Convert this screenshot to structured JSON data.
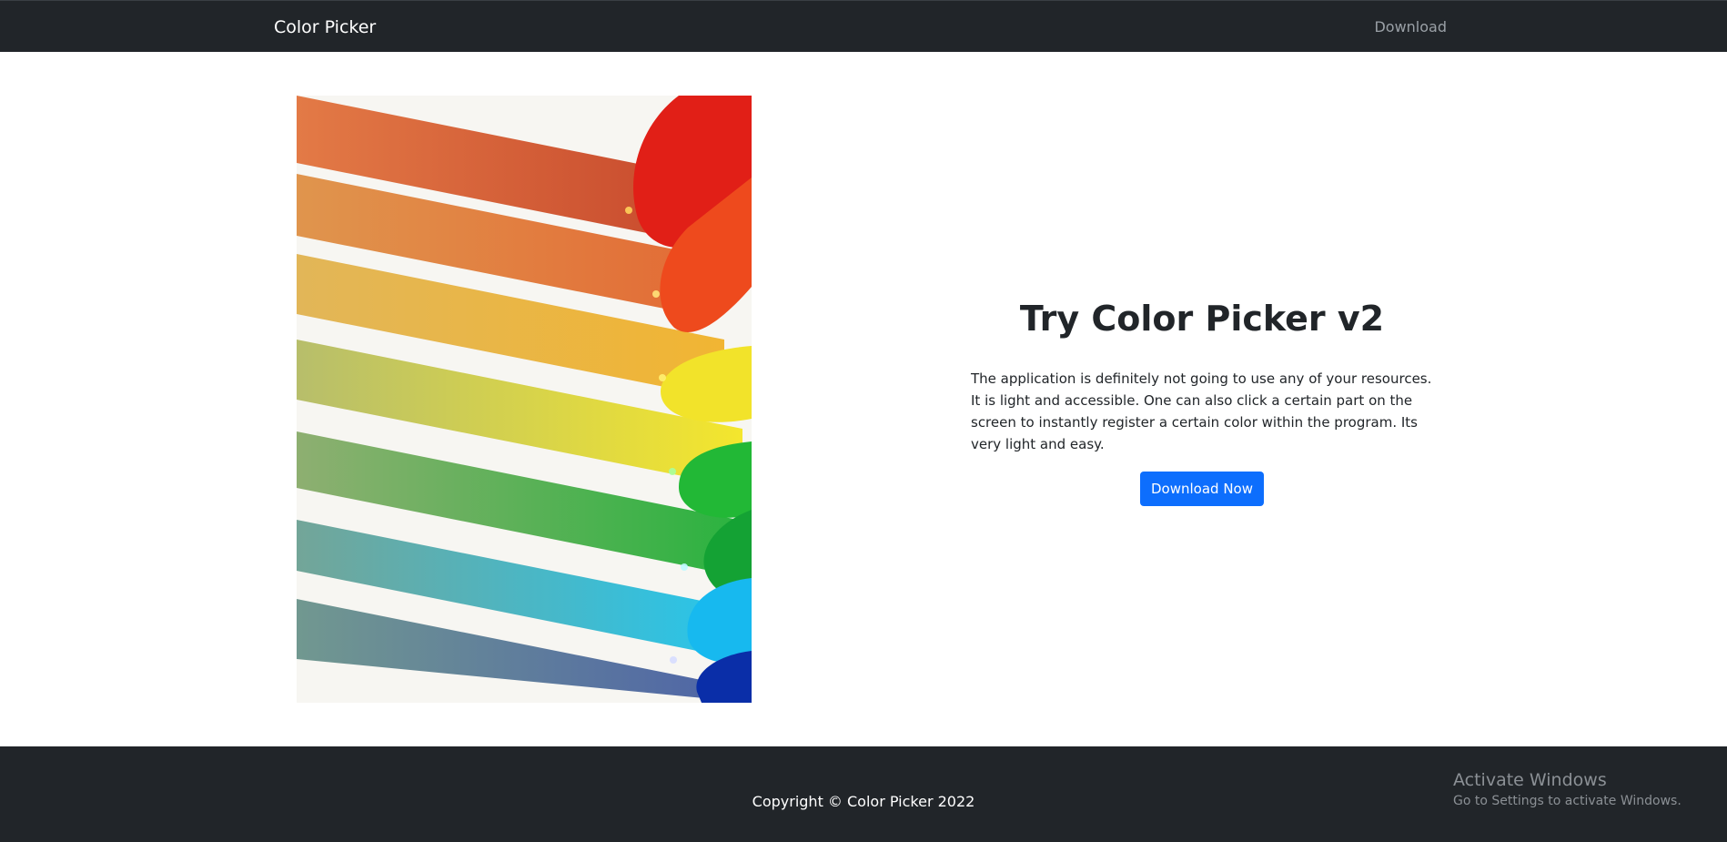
{
  "navbar": {
    "brand": "Color Picker",
    "download_link": "Download"
  },
  "hero": {
    "title": "Try Color Picker v2",
    "description": "The application is definitely not going to use any of your resources. It is light and accessible. One can also click a certain part on the screen to instantly register a certain color within the program. Its very light and easy.",
    "button_label": "Download Now"
  },
  "footer": {
    "copyright": "Copyright © Color Picker 2022"
  },
  "watermark": {
    "title": "Activate Windows",
    "subtitle": "Go to Settings to activate Windows."
  },
  "colors": {
    "nav_background": "#212529",
    "primary_button": "#0d6efd",
    "footer_background": "#212529"
  },
  "icons": {
    "hero_image": "rainbow-crayons-image"
  }
}
